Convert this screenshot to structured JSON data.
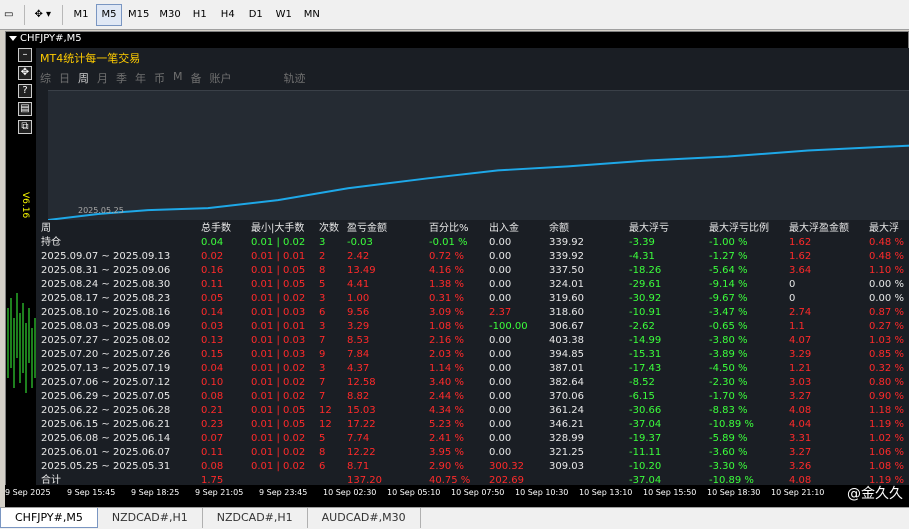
{
  "toolbar": {
    "timeframes": [
      "M1",
      "M5",
      "M15",
      "M30",
      "H1",
      "H4",
      "D1",
      "W1",
      "MN"
    ],
    "active_timeframe": "M5"
  },
  "chart": {
    "title": "CHFJPY#,M5",
    "vertical_label": "V6.16",
    "panel_title": "MT4统计每一笔交易",
    "tabs": [
      "综",
      "日",
      "周",
      "月",
      "季",
      "年",
      "币",
      "M",
      "备",
      "账户",
      "轨迹"
    ],
    "active_tab": "周",
    "graph_date": "2025.05.25",
    "headers": [
      "周",
      "总手数",
      "最小|大手数",
      "次数",
      "盈亏金额",
      "百分比%",
      "出入金",
      "余额",
      "最大浮亏",
      "最大浮亏比例",
      "最大浮盈金额",
      "最大浮"
    ],
    "position_row": {
      "label": "持仓",
      "lots": "0.04",
      "minmax": "0.01 | 0.02",
      "count": "3",
      "pl": "-0.03",
      "pct": "-0.01 %",
      "io": "0.00",
      "balance": "339.92",
      "maxfloat": "-3.39",
      "maxfloat_pct": "-1.00 %",
      "maxprofit": "1.62",
      "last": "0.48 %"
    },
    "rows": [
      {
        "week": "2025.09.07 ~ 2025.09.13",
        "lots": "0.02",
        "minmax": "0.01 | 0.01",
        "count": "2",
        "pl": "2.42",
        "pct": "0.72 %",
        "io": "0.00",
        "balance": "339.92",
        "maxfloat": "-4.31",
        "maxfloat_pct": "-1.27 %",
        "maxprofit": "1.62",
        "last": "0.48 %"
      },
      {
        "week": "2025.08.31 ~ 2025.09.06",
        "lots": "0.16",
        "minmax": "0.01 | 0.05",
        "count": "8",
        "pl": "13.49",
        "pct": "4.16 %",
        "io": "0.00",
        "balance": "337.50",
        "maxfloat": "-18.26",
        "maxfloat_pct": "-5.64 %",
        "maxprofit": "3.64",
        "last": "1.10 %"
      },
      {
        "week": "2025.08.24 ~ 2025.08.30",
        "lots": "0.11",
        "minmax": "0.01 | 0.05",
        "count": "5",
        "pl": "4.41",
        "pct": "1.38 %",
        "io": "0.00",
        "balance": "324.01",
        "maxfloat": "-29.61",
        "maxfloat_pct": "-9.14 %",
        "maxprofit": "0",
        "last": "0.00 %"
      },
      {
        "week": "2025.08.17 ~ 2025.08.23",
        "lots": "0.05",
        "minmax": "0.01 | 0.02",
        "count": "3",
        "pl": "1.00",
        "pct": "0.31 %",
        "io": "0.00",
        "balance": "319.60",
        "maxfloat": "-30.92",
        "maxfloat_pct": "-9.67 %",
        "maxprofit": "0",
        "last": "0.00 %"
      },
      {
        "week": "2025.08.10 ~ 2025.08.16",
        "lots": "0.14",
        "minmax": "0.01 | 0.03",
        "count": "6",
        "pl": "9.56",
        "pct": "3.09 %",
        "io": "2.37",
        "balance": "318.60",
        "maxfloat": "-10.91",
        "maxfloat_pct": "-3.47 %",
        "maxprofit": "2.74",
        "last": "0.87 %"
      },
      {
        "week": "2025.08.03 ~ 2025.08.09",
        "lots": "0.03",
        "minmax": "0.01 | 0.01",
        "count": "3",
        "pl": "3.29",
        "pct": "1.08 %",
        "io": "-100.00",
        "balance": "306.67",
        "maxfloat": "-2.62",
        "maxfloat_pct": "-0.65 %",
        "maxprofit": "1.1",
        "last": "0.27 %"
      },
      {
        "week": "2025.07.27 ~ 2025.08.02",
        "lots": "0.13",
        "minmax": "0.01 | 0.03",
        "count": "7",
        "pl": "8.53",
        "pct": "2.16 %",
        "io": "0.00",
        "balance": "403.38",
        "maxfloat": "-14.99",
        "maxfloat_pct": "-3.80 %",
        "maxprofit": "4.07",
        "last": "1.03 %"
      },
      {
        "week": "2025.07.20 ~ 2025.07.26",
        "lots": "0.15",
        "minmax": "0.01 | 0.03",
        "count": "9",
        "pl": "7.84",
        "pct": "2.03 %",
        "io": "0.00",
        "balance": "394.85",
        "maxfloat": "-15.31",
        "maxfloat_pct": "-3.89 %",
        "maxprofit": "3.29",
        "last": "0.85 %"
      },
      {
        "week": "2025.07.13 ~ 2025.07.19",
        "lots": "0.04",
        "minmax": "0.01 | 0.02",
        "count": "3",
        "pl": "4.37",
        "pct": "1.14 %",
        "io": "0.00",
        "balance": "387.01",
        "maxfloat": "-17.43",
        "maxfloat_pct": "-4.50 %",
        "maxprofit": "1.21",
        "last": "0.32 %"
      },
      {
        "week": "2025.07.06 ~ 2025.07.12",
        "lots": "0.10",
        "minmax": "0.01 | 0.02",
        "count": "7",
        "pl": "12.58",
        "pct": "3.40 %",
        "io": "0.00",
        "balance": "382.64",
        "maxfloat": "-8.52",
        "maxfloat_pct": "-2.30 %",
        "maxprofit": "3.03",
        "last": "0.80 %"
      },
      {
        "week": "2025.06.29 ~ 2025.07.05",
        "lots": "0.08",
        "minmax": "0.01 | 0.02",
        "count": "7",
        "pl": "8.82",
        "pct": "2.44 %",
        "io": "0.00",
        "balance": "370.06",
        "maxfloat": "-6.15",
        "maxfloat_pct": "-1.70 %",
        "maxprofit": "3.27",
        "last": "0.90 %"
      },
      {
        "week": "2025.06.22 ~ 2025.06.28",
        "lots": "0.21",
        "minmax": "0.01 | 0.05",
        "count": "12",
        "pl": "15.03",
        "pct": "4.34 %",
        "io": "0.00",
        "balance": "361.24",
        "maxfloat": "-30.66",
        "maxfloat_pct": "-8.83 %",
        "maxprofit": "4.08",
        "last": "1.18 %"
      },
      {
        "week": "2025.06.15 ~ 2025.06.21",
        "lots": "0.23",
        "minmax": "0.01 | 0.05",
        "count": "12",
        "pl": "17.22",
        "pct": "5.23 %",
        "io": "0.00",
        "balance": "346.21",
        "maxfloat": "-37.04",
        "maxfloat_pct": "-10.89 %",
        "maxprofit": "4.04",
        "last": "1.19 %"
      },
      {
        "week": "2025.06.08 ~ 2025.06.14",
        "lots": "0.07",
        "minmax": "0.01 | 0.02",
        "count": "5",
        "pl": "7.74",
        "pct": "2.41 %",
        "io": "0.00",
        "balance": "328.99",
        "maxfloat": "-19.37",
        "maxfloat_pct": "-5.89 %",
        "maxprofit": "3.31",
        "last": "1.02 %"
      },
      {
        "week": "2025.06.01 ~ 2025.06.07",
        "lots": "0.11",
        "minmax": "0.01 | 0.02",
        "count": "8",
        "pl": "12.22",
        "pct": "3.95 %",
        "io": "0.00",
        "balance": "321.25",
        "maxfloat": "-11.11",
        "maxfloat_pct": "-3.60 %",
        "maxprofit": "3.27",
        "last": "1.06 %"
      },
      {
        "week": "2025.05.25 ~ 2025.05.31",
        "lots": "0.08",
        "minmax": "0.01 | 0.02",
        "count": "6",
        "pl": "8.71",
        "pct": "2.90 %",
        "io": "300.32",
        "balance": "309.03",
        "maxfloat": "-10.20",
        "maxfloat_pct": "-3.30 %",
        "maxprofit": "3.26",
        "last": "1.08 %"
      }
    ],
    "total_row": {
      "label": "合计",
      "lots": "1.75",
      "minmax": "",
      "count": "",
      "pl": "137.20",
      "pct": "40.75 %",
      "io": "202.69",
      "balance": "",
      "maxfloat": "-37.04",
      "maxfloat_pct": "-10.89 %",
      "maxprofit": "4.08",
      "last": "1.19 %"
    },
    "time_axis": [
      "9 Sep 2025",
      "9 Sep 15:45",
      "9 Sep 18:25",
      "9 Sep 21:05",
      "9 Sep 23:45",
      "10 Sep 02:30",
      "10 Sep 05:10",
      "10 Sep 07:50",
      "10 Sep 10:30",
      "10 Sep 13:10",
      "10 Sep 15:50",
      "10 Sep 18:30",
      "10 Sep 21:10"
    ],
    "watermark": "@金久久"
  },
  "bottom_tabs": [
    "CHFJPY#,M5",
    "NZDCAD#,H1",
    "NZDCAD#,H1",
    "AUDCAD#,M30"
  ],
  "active_bottom_tab": "CHFJPY#,M5"
}
